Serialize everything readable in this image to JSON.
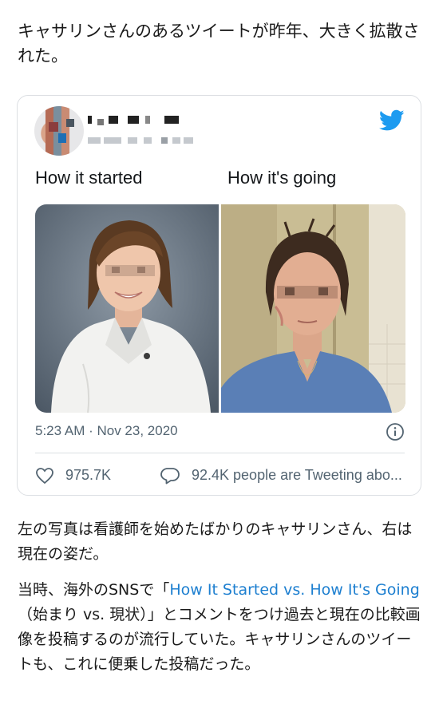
{
  "article": {
    "lead": "キャサリンさんのあるツイートが昨年、大きく拡散された。",
    "para1": "左の写真は看護師を始めたばかりのキャサリンさん、右は現在の姿だ。",
    "para2_before": "当時、海外のSNSで「",
    "para2_link": "How It Started vs. How It's Going",
    "para2_after": "（始まり vs. 現状）」とコメントをつけ過去と現在の比較画像を投稿するのが流行していた。キャサリンさんのツイートも、これに便乗した投稿だった。"
  },
  "tweet": {
    "text_left": "How it started",
    "text_right": "How it's going",
    "timestamp": "5:23 AM · Nov 23, 2020",
    "likes": "975.7K",
    "tweeting": "92.4K people are Tweeting abo..."
  },
  "colors": {
    "twitter_blue": "#1d9bf0",
    "link": "#1d7fd0",
    "muted": "#536471"
  },
  "icons": {
    "brand": "twitter-bird-icon",
    "info": "info-icon",
    "like": "heart-icon",
    "reply": "speech-bubble-icon"
  }
}
